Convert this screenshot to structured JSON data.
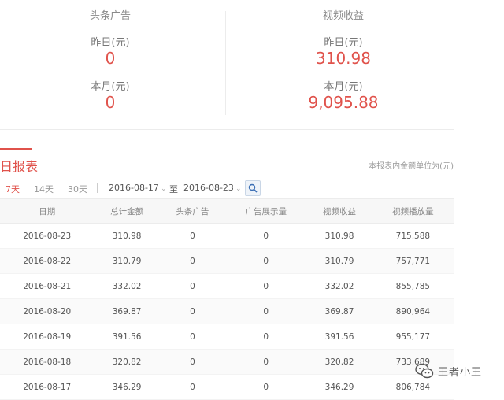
{
  "summary": {
    "left": {
      "title": "头条广告",
      "yesterday_label": "昨日(元)",
      "yesterday_value": "0",
      "month_label": "本月(元)",
      "month_value": "0"
    },
    "right": {
      "title": "视频收益",
      "yesterday_label": "昨日(元)",
      "yesterday_value": "310.98",
      "month_label": "本月(元)",
      "month_value": "9,095.88"
    }
  },
  "report": {
    "title": "日报表",
    "note": "本报表内金额单位为(元)",
    "periods": [
      "7天",
      "14天",
      "30天"
    ],
    "active_period": "7天",
    "date_from": "2016-08-17",
    "date_to": "2016-08-23",
    "to_label": "至"
  },
  "table": {
    "headers": [
      "日期",
      "总计金额",
      "头条广告",
      "广告展示量",
      "视频收益",
      "视频播放量"
    ],
    "rows": [
      [
        "2016-08-23",
        "310.98",
        "0",
        "0",
        "310.98",
        "715,588"
      ],
      [
        "2016-08-22",
        "310.79",
        "0",
        "0",
        "310.79",
        "757,771"
      ],
      [
        "2016-08-21",
        "332.02",
        "0",
        "0",
        "332.02",
        "855,785"
      ],
      [
        "2016-08-20",
        "369.87",
        "0",
        "0",
        "369.87",
        "890,964"
      ],
      [
        "2016-08-19",
        "391.56",
        "0",
        "0",
        "391.56",
        "955,177"
      ],
      [
        "2016-08-18",
        "320.82",
        "0",
        "0",
        "320.82",
        "733,689"
      ],
      [
        "2016-08-17",
        "346.29",
        "0",
        "0",
        "346.29",
        "806,784"
      ]
    ]
  },
  "watermark": {
    "text": "王者小王",
    "icon": "wechat-icon"
  },
  "colors": {
    "accent": "#e0524b",
    "muted": "#999999"
  }
}
